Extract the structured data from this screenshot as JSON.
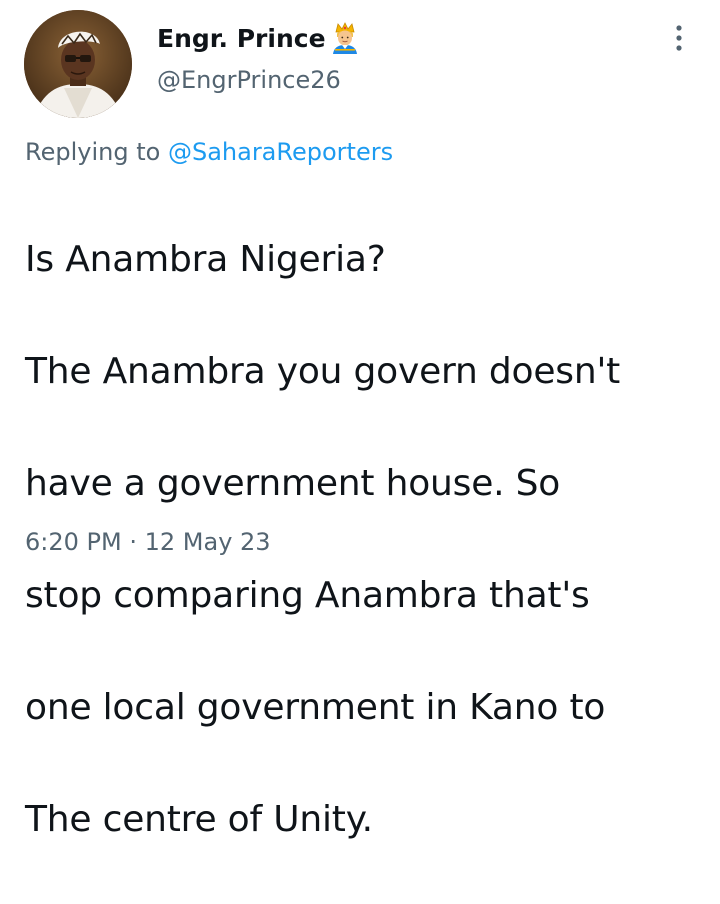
{
  "tweet": {
    "author": {
      "display_name": "Engr. Prince",
      "badge_emoji": "man-with-crown-emoji",
      "handle": "@EngrPrince26",
      "avatar": "profile-photo"
    },
    "reply": {
      "prefix": "Replying to",
      "target": "@SaharaReporters"
    },
    "text_lines": [
      "Is Anambra Nigeria?",
      "The Anambra you govern doesn't",
      "have a government house. So",
      "stop comparing Anambra that's",
      "one local government in Kano to",
      "The centre of Unity."
    ],
    "time": "6:20 PM",
    "separator": "·",
    "date": "12 May 23",
    "more_icon": "more-vertical-icon"
  },
  "colors": {
    "text": "#0f1419",
    "secondary": "#536471",
    "link": "#1d9bf0",
    "background": "#ffffff"
  }
}
